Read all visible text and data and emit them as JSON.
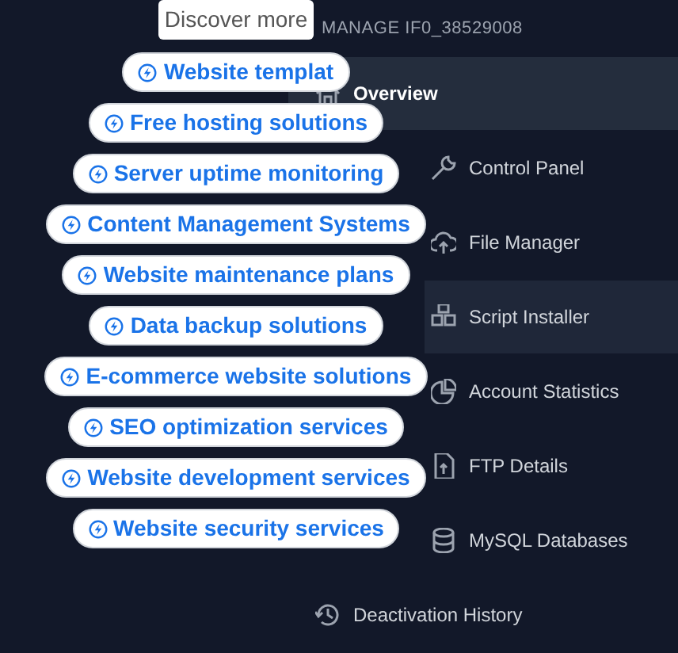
{
  "popup": {
    "title": "Discover more",
    "suggestions": [
      {
        "label": "Website templat"
      },
      {
        "label": "Free hosting solutions"
      },
      {
        "label": "Server uptime monitoring"
      },
      {
        "label": "Content Management Systems"
      },
      {
        "label": "Website maintenance plans"
      },
      {
        "label": "Data backup solutions"
      },
      {
        "label": "E-commerce website solutions"
      },
      {
        "label": "SEO optimization services"
      },
      {
        "label": "Website development services"
      },
      {
        "label": "Website security services"
      }
    ]
  },
  "sidebar": {
    "heading": "MANAGE IF0_38529008",
    "items": [
      {
        "label": "Overview",
        "selected": true
      },
      {
        "label": "Control Panel",
        "selected": false
      },
      {
        "label": "File Manager",
        "selected": false
      },
      {
        "label": "Script Installer",
        "selected": false,
        "hovered": true
      },
      {
        "label": "Account Statistics",
        "selected": false
      },
      {
        "label": "FTP Details",
        "selected": false
      },
      {
        "label": "MySQL Databases",
        "selected": false
      },
      {
        "label": "Deactivation History",
        "selected": false
      }
    ]
  }
}
